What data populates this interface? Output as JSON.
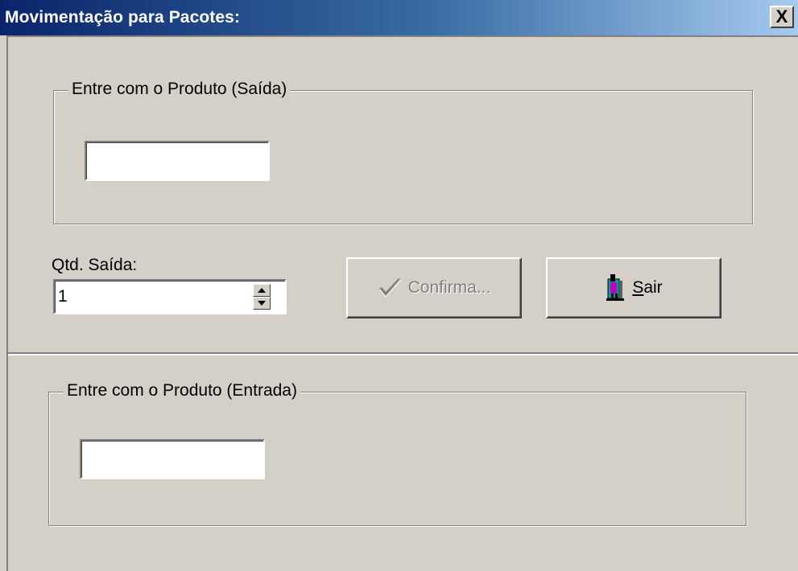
{
  "window": {
    "title": "Movimentação para Pacotes:",
    "close_glyph": "X"
  },
  "saida_group": {
    "label": "Entre com o Produto (Saída)",
    "product_value": ""
  },
  "quantity": {
    "label": "Qtd. Saída:",
    "value": "1"
  },
  "buttons": {
    "confirm_label": "Confirma...",
    "confirm_enabled": false,
    "confirm_icon": "check-icon",
    "exit_label_rest": "air",
    "exit_label_mnemonic": "S",
    "exit_icon": "exit-door-icon"
  },
  "entrada_group": {
    "label": "Entre com o Produto (Entrada)",
    "product_value": ""
  },
  "colors": {
    "face": "#d4d0c8",
    "title_start": "#0a246a",
    "title_end": "#a6caf0"
  }
}
